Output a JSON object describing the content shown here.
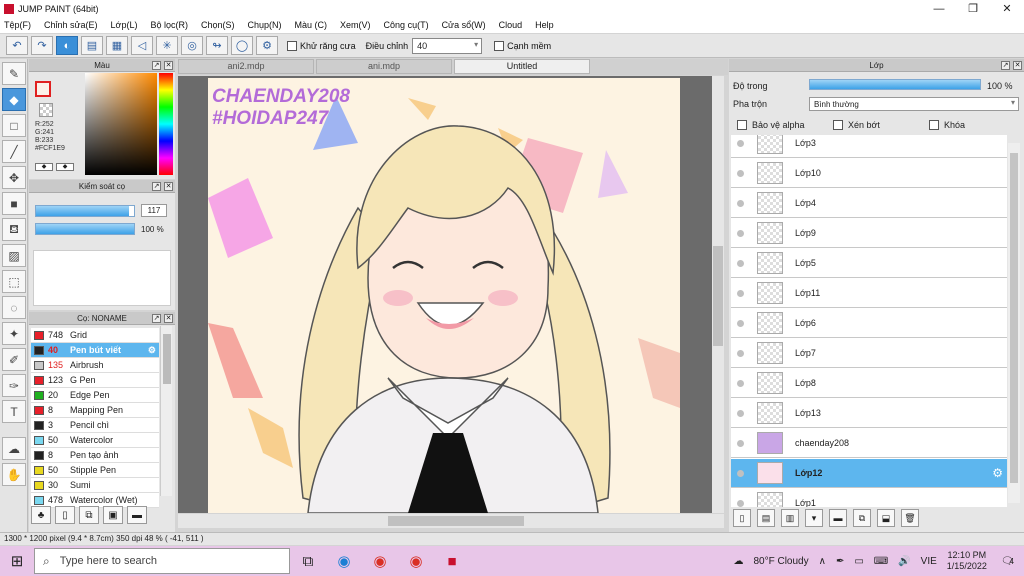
{
  "window": {
    "title": "JUMP PAINT (64bit)",
    "minimize": "—",
    "maximize": "❐",
    "close": "✕"
  },
  "menu": [
    "Tệp(F)",
    "Chỉnh sửa(E)",
    "Lớp(L)",
    "Bộ lọc(R)",
    "Chọn(S)",
    "Chụp(N)",
    "Màu (C)",
    "Xem(V)",
    "Công cụ(T)",
    "Cửa sổ(W)",
    "Cloud",
    "Help"
  ],
  "toolbar": {
    "antialias_label": "Khử răng cưa",
    "correction_label": "Điều chỉnh",
    "correction_value": "40",
    "soft_edge_label": "Cạnh mềm"
  },
  "color_panel": {
    "title": "Màu",
    "r": "R:252",
    "g": "G:241",
    "b": "B:233",
    "hex": "#FCF1E9",
    "fg_color": "#FCF1E9"
  },
  "brush_control": {
    "title": "Kiểm soát cọ",
    "size_value": "117",
    "opacity_value": "100 %"
  },
  "brush_list": {
    "title": "Cọ: NONAME",
    "items": [
      {
        "size": "748",
        "name": "Grid",
        "color": "#e8202a"
      },
      {
        "size": "40",
        "name": "Pen bút viết",
        "color": "#222222"
      },
      {
        "size": "135",
        "name": "Airbrush",
        "color": "#c8c8c8"
      },
      {
        "size": "123",
        "name": "G Pen",
        "color": "#e8202a"
      },
      {
        "size": "20",
        "name": "Edge Pen",
        "color": "#20b020"
      },
      {
        "size": "8",
        "name": "Mapping Pen",
        "color": "#e8202a"
      },
      {
        "size": "3",
        "name": "Pencil chì",
        "color": "#222222"
      },
      {
        "size": "50",
        "name": "Watercolor",
        "color": "#7ad8f0"
      },
      {
        "size": "8",
        "name": "Pen tạo ảnh",
        "color": "#222222"
      },
      {
        "size": "50",
        "name": "Stipple Pen",
        "color": "#e8d820"
      },
      {
        "size": "30",
        "name": "Sumi",
        "color": "#e8d820"
      },
      {
        "size": "478",
        "name": "Watercolor (Wet)",
        "color": "#7ad8f0"
      }
    ]
  },
  "documents": {
    "tabs": [
      "ani2.mdp",
      "ani.mdp",
      "Untitled"
    ]
  },
  "canvas": {
    "watermark_line1": "CHAENDAY208",
    "watermark_line2": "#HOIDAP247"
  },
  "layers": {
    "title": "Lớp",
    "opacity_label": "Độ trong",
    "opacity_value": "100 %",
    "blend_label": "Pha trộn",
    "blend_value": "Bình thường",
    "protect_alpha": "Bảo vệ alpha",
    "clipping": "Xén bớt",
    "lock": "Khóa",
    "items": [
      "Lớp3",
      "Lớp10",
      "Lớp4",
      "Lớp9",
      "Lớp5",
      "Lớp11",
      "Lớp6",
      "Lớp7",
      "Lớp8",
      "Lớp13",
      "chaenday208",
      "Lớp12",
      "Lớp1"
    ]
  },
  "status": {
    "text": "1300 * 1200 pixel  (9.4 * 8.7cm)  350 dpi  48 %  ( -41, 511 )"
  },
  "taskbar": {
    "search_placeholder": "Type here to search",
    "weather": "80°F  Cloudy",
    "lang": "VIE",
    "time": "12:10 PM",
    "date": "1/15/2022",
    "notifications": "4"
  }
}
